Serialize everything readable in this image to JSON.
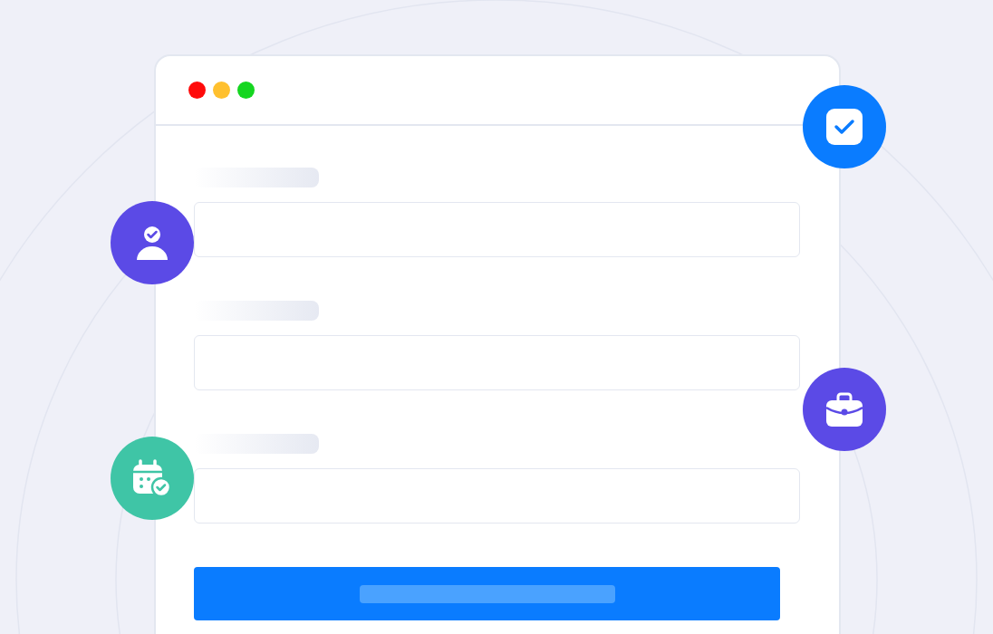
{
  "window": {
    "controls": [
      {
        "color": "#ff0b0b"
      },
      {
        "color": "#ffc02e"
      },
      {
        "color": "#15d620"
      }
    ]
  },
  "fields": [
    {
      "kind": "text"
    },
    {
      "kind": "text"
    },
    {
      "kind": "text"
    }
  ],
  "submit": {
    "kind": "primary"
  },
  "badges": [
    {
      "kind": "checkbox",
      "color": "#0a7cff"
    },
    {
      "kind": "person",
      "color": "#5b4ae6"
    },
    {
      "kind": "briefcase",
      "color": "#5b4ae6"
    },
    {
      "kind": "calendar",
      "color": "#3fc5a6"
    }
  ]
}
